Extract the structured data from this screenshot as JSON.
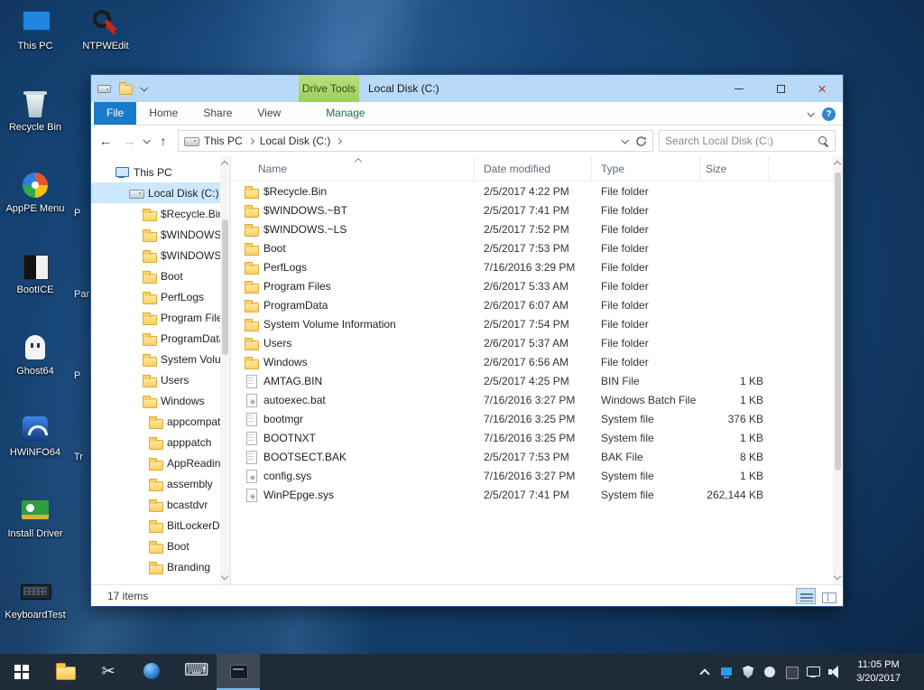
{
  "desktop": {
    "icons": [
      {
        "label": "This PC",
        "icon": "pc",
        "pos": "r1c1"
      },
      {
        "label": "NTPWEdit",
        "icon": "ntpwedit",
        "pos": "r1c2"
      },
      {
        "label": "Recycle Bin",
        "icon": "recycle",
        "pos": "r2c1"
      },
      {
        "label": "AppPE Menu",
        "icon": "apppe",
        "pos": "r3c1"
      },
      {
        "label": "BootICE",
        "icon": "bootice",
        "pos": "r4c1"
      },
      {
        "label": "Ghost64",
        "icon": "ghost",
        "pos": "r5c1"
      },
      {
        "label": "HWiNFO64",
        "icon": "hwinfo",
        "pos": "r6c1"
      },
      {
        "label": "Install Driver",
        "icon": "driver",
        "pos": "r7c1"
      },
      {
        "label": "KeyboardTest",
        "icon": "keyboardtest",
        "pos": "r8c1"
      }
    ],
    "partial_icons": [
      {
        "label": "P",
        "pos": "p3"
      },
      {
        "label": "Par",
        "pos": "p4"
      },
      {
        "label": "P",
        "pos": "p5"
      },
      {
        "label": "Tr",
        "pos": "p6"
      }
    ]
  },
  "window": {
    "title": "Local Disk (C:)",
    "contextual_tab": "Drive Tools",
    "ribbon_tabs": [
      {
        "label": "File",
        "state": "primary"
      },
      {
        "label": "Home",
        "state": ""
      },
      {
        "label": "Share",
        "state": ""
      },
      {
        "label": "View",
        "state": ""
      },
      {
        "label": "Manage",
        "state": "contextual"
      }
    ],
    "address": {
      "breadcrumbs": [
        {
          "label": "This PC"
        },
        {
          "label": "Local Disk (C:)"
        }
      ],
      "search_placeholder": "Search Local Disk (C:)"
    },
    "nav": {
      "items": [
        {
          "label": "This PC",
          "icon": "pc",
          "depth": "d0",
          "state": ""
        },
        {
          "label": "Local Disk (C:)",
          "icon": "drive",
          "depth": "d1",
          "state": "selected"
        },
        {
          "label": "$Recycle.Bin",
          "icon": "folder",
          "depth": "d2",
          "state": ""
        },
        {
          "label": "$WINDOWS.~...",
          "icon": "folder",
          "depth": "d2",
          "state": ""
        },
        {
          "label": "$WINDOWS.~...",
          "icon": "folder",
          "depth": "d2",
          "state": ""
        },
        {
          "label": "Boot",
          "icon": "folder",
          "depth": "d2",
          "state": ""
        },
        {
          "label": "PerfLogs",
          "icon": "folder",
          "depth": "d2",
          "state": ""
        },
        {
          "label": "Program Files",
          "icon": "folder",
          "depth": "d2",
          "state": ""
        },
        {
          "label": "ProgramData",
          "icon": "folder",
          "depth": "d2",
          "state": ""
        },
        {
          "label": "System Volu...",
          "icon": "folder",
          "depth": "d2",
          "state": ""
        },
        {
          "label": "Users",
          "icon": "folder",
          "depth": "d2",
          "state": ""
        },
        {
          "label": "Windows",
          "icon": "folder",
          "depth": "d2",
          "state": ""
        },
        {
          "label": "appcompat",
          "icon": "folder",
          "depth": "d3",
          "state": ""
        },
        {
          "label": "apppatch",
          "icon": "folder",
          "depth": "d3",
          "state": ""
        },
        {
          "label": "AppReadine...",
          "icon": "folder",
          "depth": "d3",
          "state": ""
        },
        {
          "label": "assembly",
          "icon": "folder",
          "depth": "d3",
          "state": ""
        },
        {
          "label": "bcastdvr",
          "icon": "folder",
          "depth": "d3",
          "state": ""
        },
        {
          "label": "BitLockerDi...",
          "icon": "folder",
          "depth": "d3",
          "state": ""
        },
        {
          "label": "Boot",
          "icon": "folder",
          "depth": "d3",
          "state": ""
        },
        {
          "label": "Branding",
          "icon": "folder",
          "depth": "d3",
          "state": ""
        }
      ]
    },
    "columns": [
      {
        "label": "Name",
        "key": "c-name"
      },
      {
        "label": "Date modified",
        "key": "c-mod"
      },
      {
        "label": "Type",
        "key": "c-type"
      },
      {
        "label": "Size",
        "key": "c-size"
      }
    ],
    "files": [
      {
        "name": "$Recycle.Bin",
        "modified": "2/5/2017 4:22 PM",
        "type": "File folder",
        "size": "",
        "icon": "folder"
      },
      {
        "name": "$WINDOWS.~BT",
        "modified": "2/5/2017 7:41 PM",
        "type": "File folder",
        "size": "",
        "icon": "folder"
      },
      {
        "name": "$WINDOWS.~LS",
        "modified": "2/5/2017 7:52 PM",
        "type": "File folder",
        "size": "",
        "icon": "folder"
      },
      {
        "name": "Boot",
        "modified": "2/5/2017 7:53 PM",
        "type": "File folder",
        "size": "",
        "icon": "folder"
      },
      {
        "name": "PerfLogs",
        "modified": "7/16/2016 3:29 PM",
        "type": "File folder",
        "size": "",
        "icon": "folder"
      },
      {
        "name": "Program Files",
        "modified": "2/6/2017 5:33 AM",
        "type": "File folder",
        "size": "",
        "icon": "folder"
      },
      {
        "name": "ProgramData",
        "modified": "2/6/2017 6:07 AM",
        "type": "File folder",
        "size": "",
        "icon": "folder"
      },
      {
        "name": "System Volume Information",
        "modified": "2/5/2017 7:54 PM",
        "type": "File folder",
        "size": "",
        "icon": "folder"
      },
      {
        "name": "Users",
        "modified": "2/6/2017 5:37 AM",
        "type": "File folder",
        "size": "",
        "icon": "folder"
      },
      {
        "name": "Windows",
        "modified": "2/6/2017 6:56 AM",
        "type": "File folder",
        "size": "",
        "icon": "folder"
      },
      {
        "name": "AMTAG.BIN",
        "modified": "2/5/2017 4:25 PM",
        "type": "BIN File",
        "size": "1 KB",
        "icon": "file"
      },
      {
        "name": "autoexec.bat",
        "modified": "7/16/2016 3:27 PM",
        "type": "Windows Batch File",
        "size": "1 KB",
        "icon": "sysfile"
      },
      {
        "name": "bootmgr",
        "modified": "7/16/2016 3:25 PM",
        "type": "System file",
        "size": "376 KB",
        "icon": "file"
      },
      {
        "name": "BOOTNXT",
        "modified": "7/16/2016 3:25 PM",
        "type": "System file",
        "size": "1 KB",
        "icon": "file"
      },
      {
        "name": "BOOTSECT.BAK",
        "modified": "2/5/2017 7:53 PM",
        "type": "BAK File",
        "size": "8 KB",
        "icon": "file"
      },
      {
        "name": "config.sys",
        "modified": "7/16/2016 3:27 PM",
        "type": "System file",
        "size": "1 KB",
        "icon": "sysfile"
      },
      {
        "name": "WinPEpge.sys",
        "modified": "2/5/2017 7:41 PM",
        "type": "System file",
        "size": "262,144 KB",
        "icon": "sysfile"
      }
    ],
    "status": "17 items"
  },
  "taskbar": {
    "apps": [
      {
        "icon": "explorer",
        "state": ""
      },
      {
        "icon": "snip",
        "state": ""
      },
      {
        "icon": "blueapp",
        "state": ""
      },
      {
        "icon": "keyboard",
        "state": ""
      },
      {
        "icon": "imaging",
        "state": "active"
      }
    ],
    "tray": [
      {
        "icon": "tr-chevron"
      },
      {
        "icon": "tr-display"
      },
      {
        "icon": "tr-shield"
      },
      {
        "icon": "tr-orb"
      },
      {
        "icon": "tr-chip"
      },
      {
        "icon": "tr-ethernet"
      },
      {
        "icon": "tr-volume"
      }
    ],
    "clock_time": "11:05 PM",
    "clock_date": "3/20/2017"
  }
}
